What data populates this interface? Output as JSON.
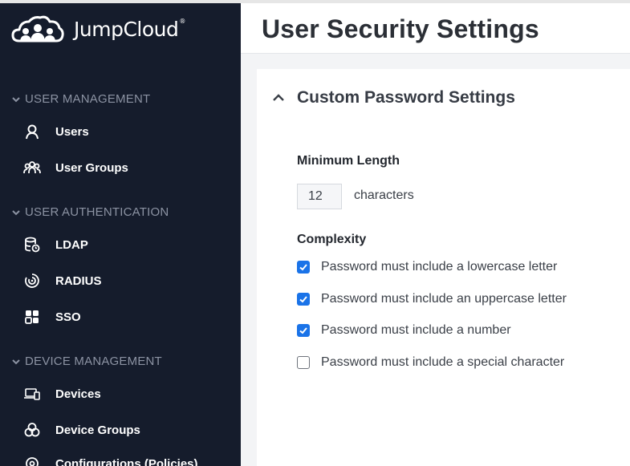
{
  "brand": {
    "name": "JumpCloud",
    "trademark": "®"
  },
  "sidebar": {
    "sections": [
      {
        "label": "USER MANAGEMENT",
        "items": [
          {
            "label": "Users",
            "icon": "user-icon"
          },
          {
            "label": "User Groups",
            "icon": "user-groups-icon"
          }
        ]
      },
      {
        "label": "USER AUTHENTICATION",
        "items": [
          {
            "label": "LDAP",
            "icon": "database-icon"
          },
          {
            "label": "RADIUS",
            "icon": "radius-icon"
          },
          {
            "label": "SSO",
            "icon": "sso-icon"
          }
        ]
      },
      {
        "label": "DEVICE MANAGEMENT",
        "items": [
          {
            "label": "Devices",
            "icon": "devices-icon"
          },
          {
            "label": "Device Groups",
            "icon": "device-groups-icon"
          },
          {
            "label": "Configurations (Policies)",
            "icon": "configurations-icon"
          }
        ]
      }
    ]
  },
  "page": {
    "title": "User Security Settings"
  },
  "password_settings": {
    "title": "Custom Password Settings",
    "min_length": {
      "label": "Minimum Length",
      "value": "12",
      "unit": "characters"
    },
    "complexity": {
      "label": "Complexity",
      "options": [
        {
          "label": "Password must include a lowercase letter",
          "checked": true
        },
        {
          "label": "Password must include an uppercase letter",
          "checked": true
        },
        {
          "label": "Password must include a number",
          "checked": true
        },
        {
          "label": "Password must include a special character",
          "checked": false
        }
      ]
    }
  },
  "colors": {
    "sidebar_bg": "#151c2c",
    "checkbox_checked": "#1a73e8",
    "section_text": "#8c93a3"
  }
}
